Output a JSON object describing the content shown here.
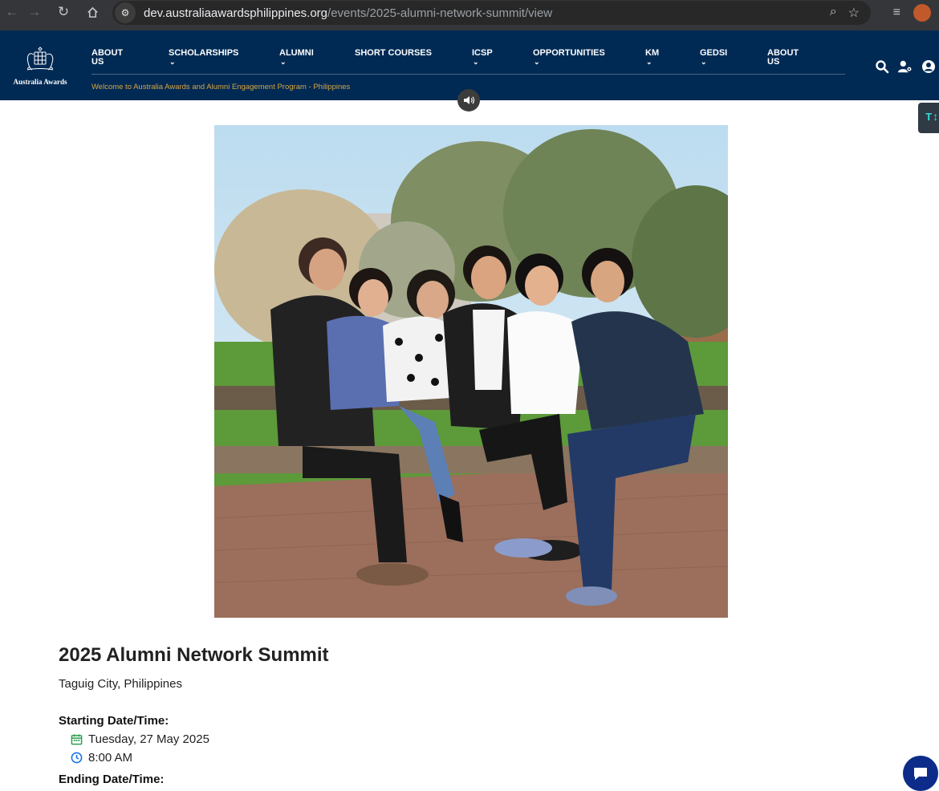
{
  "browser": {
    "url_host": "dev.australiaawardsphilippines.org",
    "url_path": "/events/2025-alumni-network-summit/view"
  },
  "header": {
    "logo_text": "Australia Awards",
    "welcome": "Welcome to Australia Awards and Alumni Engagement Program - Philippines",
    "nav": [
      {
        "label": "ABOUT US"
      },
      {
        "label": "SCHOLARSHIPS"
      },
      {
        "label": "ALUMNI"
      },
      {
        "label": "SHORT COURSES"
      },
      {
        "label": "ICSP"
      },
      {
        "label": "OPPORTUNITIES"
      },
      {
        "label": "KM"
      },
      {
        "label": "GEDSI"
      },
      {
        "label": "ABOUT US"
      }
    ]
  },
  "side_tab": {
    "text": "T↕"
  },
  "event": {
    "title": "2025 Alumni Network Summit",
    "location": "Taguig City, Philippines",
    "start_label": "Starting Date/Time:",
    "start_date": "Tuesday, 27 May 2025",
    "start_time": "8:00 AM",
    "end_label": "Ending Date/Time:"
  },
  "colors": {
    "header_bg": "#002a54",
    "welcome_text": "#d9a441",
    "calendar_icon": "#2e9e4f",
    "clock_icon": "#1a73e8",
    "chat_button": "#0d2c8a"
  }
}
